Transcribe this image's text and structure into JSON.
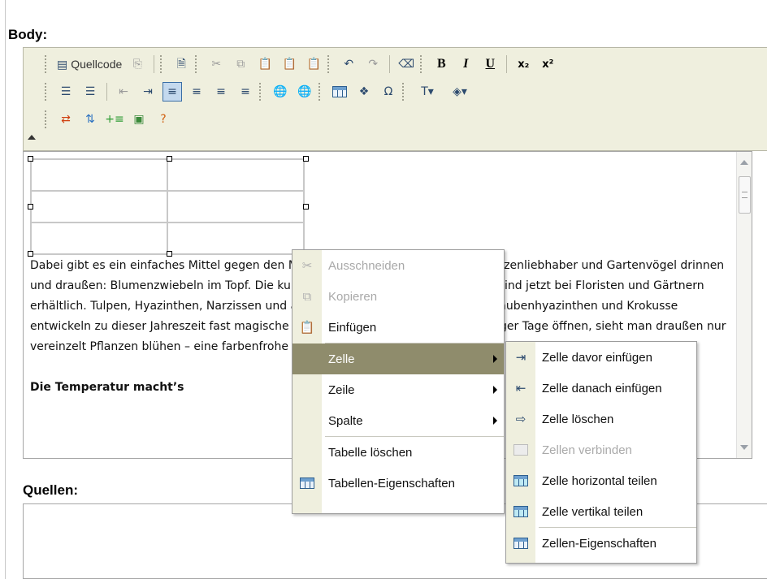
{
  "labels": {
    "body": "Body:",
    "quellen": "Quellen:"
  },
  "toolbar": {
    "source_label": "Quellcode",
    "row1": [
      "source-icon",
      "paste-disabled-icon",
      "new-doc-icon",
      "cut-icon",
      "copy-icon",
      "paste-icon",
      "paste-text-icon",
      "paste-word-icon",
      "undo-icon",
      "redo-icon",
      "eraser-icon",
      "bold",
      "italic",
      "underline",
      "subscript",
      "superscript"
    ],
    "bold": "B",
    "italic": "I",
    "underline": "U",
    "subscript": "x₂",
    "superscript": "x²"
  },
  "editor": {
    "paragraph": "Dabei gibt es ein einfaches Mittel gegen den Mangel an Frühlingsgefühlen für Pflanzenliebhaber und Gartenvögel drinnen und draußen: Blumenzwiebeln im Topf. Die kurz vor der Blüte stehenden Pflanzen sind jetzt bei Floristen und Gärtnern erhältlich. Tulpen, Hyazinthen, Narzissen und andere Zwiebelblumenzwerge wie Traubenhyazinthen und Krokusse entwickeln zu dieser Jahreszeit fast magische Kräfte: Wenn sie sich innerhalb weniger Tage öffnen, sieht man draußen nur vereinzelt Pflanzen blühen – eine farbenfrohe Ausnahme für die Wohnung.",
    "subheading": "Die Temperatur macht’s"
  },
  "context_menu": {
    "items": [
      {
        "label": "Ausschneiden",
        "icon": "cut-icon",
        "disabled": true
      },
      {
        "label": "Kopieren",
        "icon": "copy-icon",
        "disabled": true
      },
      {
        "label": "Einfügen",
        "icon": "paste-icon",
        "disabled": false
      },
      {
        "label": "Zelle",
        "submenu": true,
        "highlighted": true
      },
      {
        "label": "Zeile",
        "submenu": true
      },
      {
        "label": "Spalte",
        "submenu": true
      },
      {
        "label": "Tabelle löschen"
      },
      {
        "label": "Tabellen-Eigenschaften",
        "icon": "table-properties-icon"
      }
    ]
  },
  "cell_submenu": {
    "items": [
      {
        "label": "Zelle davor einfügen",
        "icon": "insert-cell-before-icon"
      },
      {
        "label": "Zelle danach einfügen",
        "icon": "insert-cell-after-icon"
      },
      {
        "label": "Zelle löschen",
        "icon": "delete-cell-icon"
      },
      {
        "label": "Zellen verbinden",
        "icon": "merge-cells-icon",
        "disabled": true
      },
      {
        "label": "Zelle horizontal teilen",
        "icon": "split-horizontal-icon"
      },
      {
        "label": "Zelle vertikal teilen",
        "icon": "split-vertical-icon"
      },
      {
        "label": "Zellen-Eigenschaften",
        "icon": "cell-properties-icon"
      }
    ]
  },
  "colors": {
    "toolbar_bg": "#efefde",
    "menu_highlight": "#8f8c6c",
    "active_button": "#c4d9ee"
  }
}
